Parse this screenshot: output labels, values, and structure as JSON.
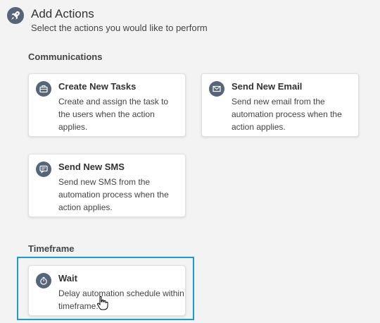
{
  "header": {
    "title": "Add Actions",
    "subtitle": "Select the actions you would like to perform",
    "icon": "rocket-icon"
  },
  "sections": {
    "communications": {
      "label": "Communications",
      "cards": [
        {
          "title": "Create New Tasks",
          "description": "Create and assign the task to the users when the action applies.",
          "icon": "briefcase-icon"
        },
        {
          "title": "Send New Email",
          "description": "Send new email from the automation process when the action applies.",
          "icon": "envelope-icon"
        },
        {
          "title": "Send New SMS",
          "description": "Send new SMS from the automation process when the action applies.",
          "icon": "sms-icon"
        }
      ]
    },
    "timeframe": {
      "label": "Timeframe",
      "cards": [
        {
          "title": "Wait",
          "description": "Delay automation schedule within timeframe.",
          "icon": "stopwatch-icon"
        }
      ]
    }
  },
  "colors": {
    "icon_bg": "#56657a",
    "highlight_border": "#1a9bd2",
    "page_bg": "#f3f3f3"
  }
}
